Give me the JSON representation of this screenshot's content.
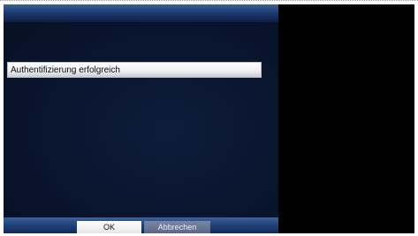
{
  "dialog": {
    "message": "Authentifizierung erfolgreich",
    "ok_label": "OK",
    "cancel_label": "Abbrechen",
    "colors": {
      "panel_background": "#0a1630",
      "bar_blue": "#24467c",
      "ok_background": "#ffffff",
      "cancel_background": "#6a7696"
    }
  }
}
